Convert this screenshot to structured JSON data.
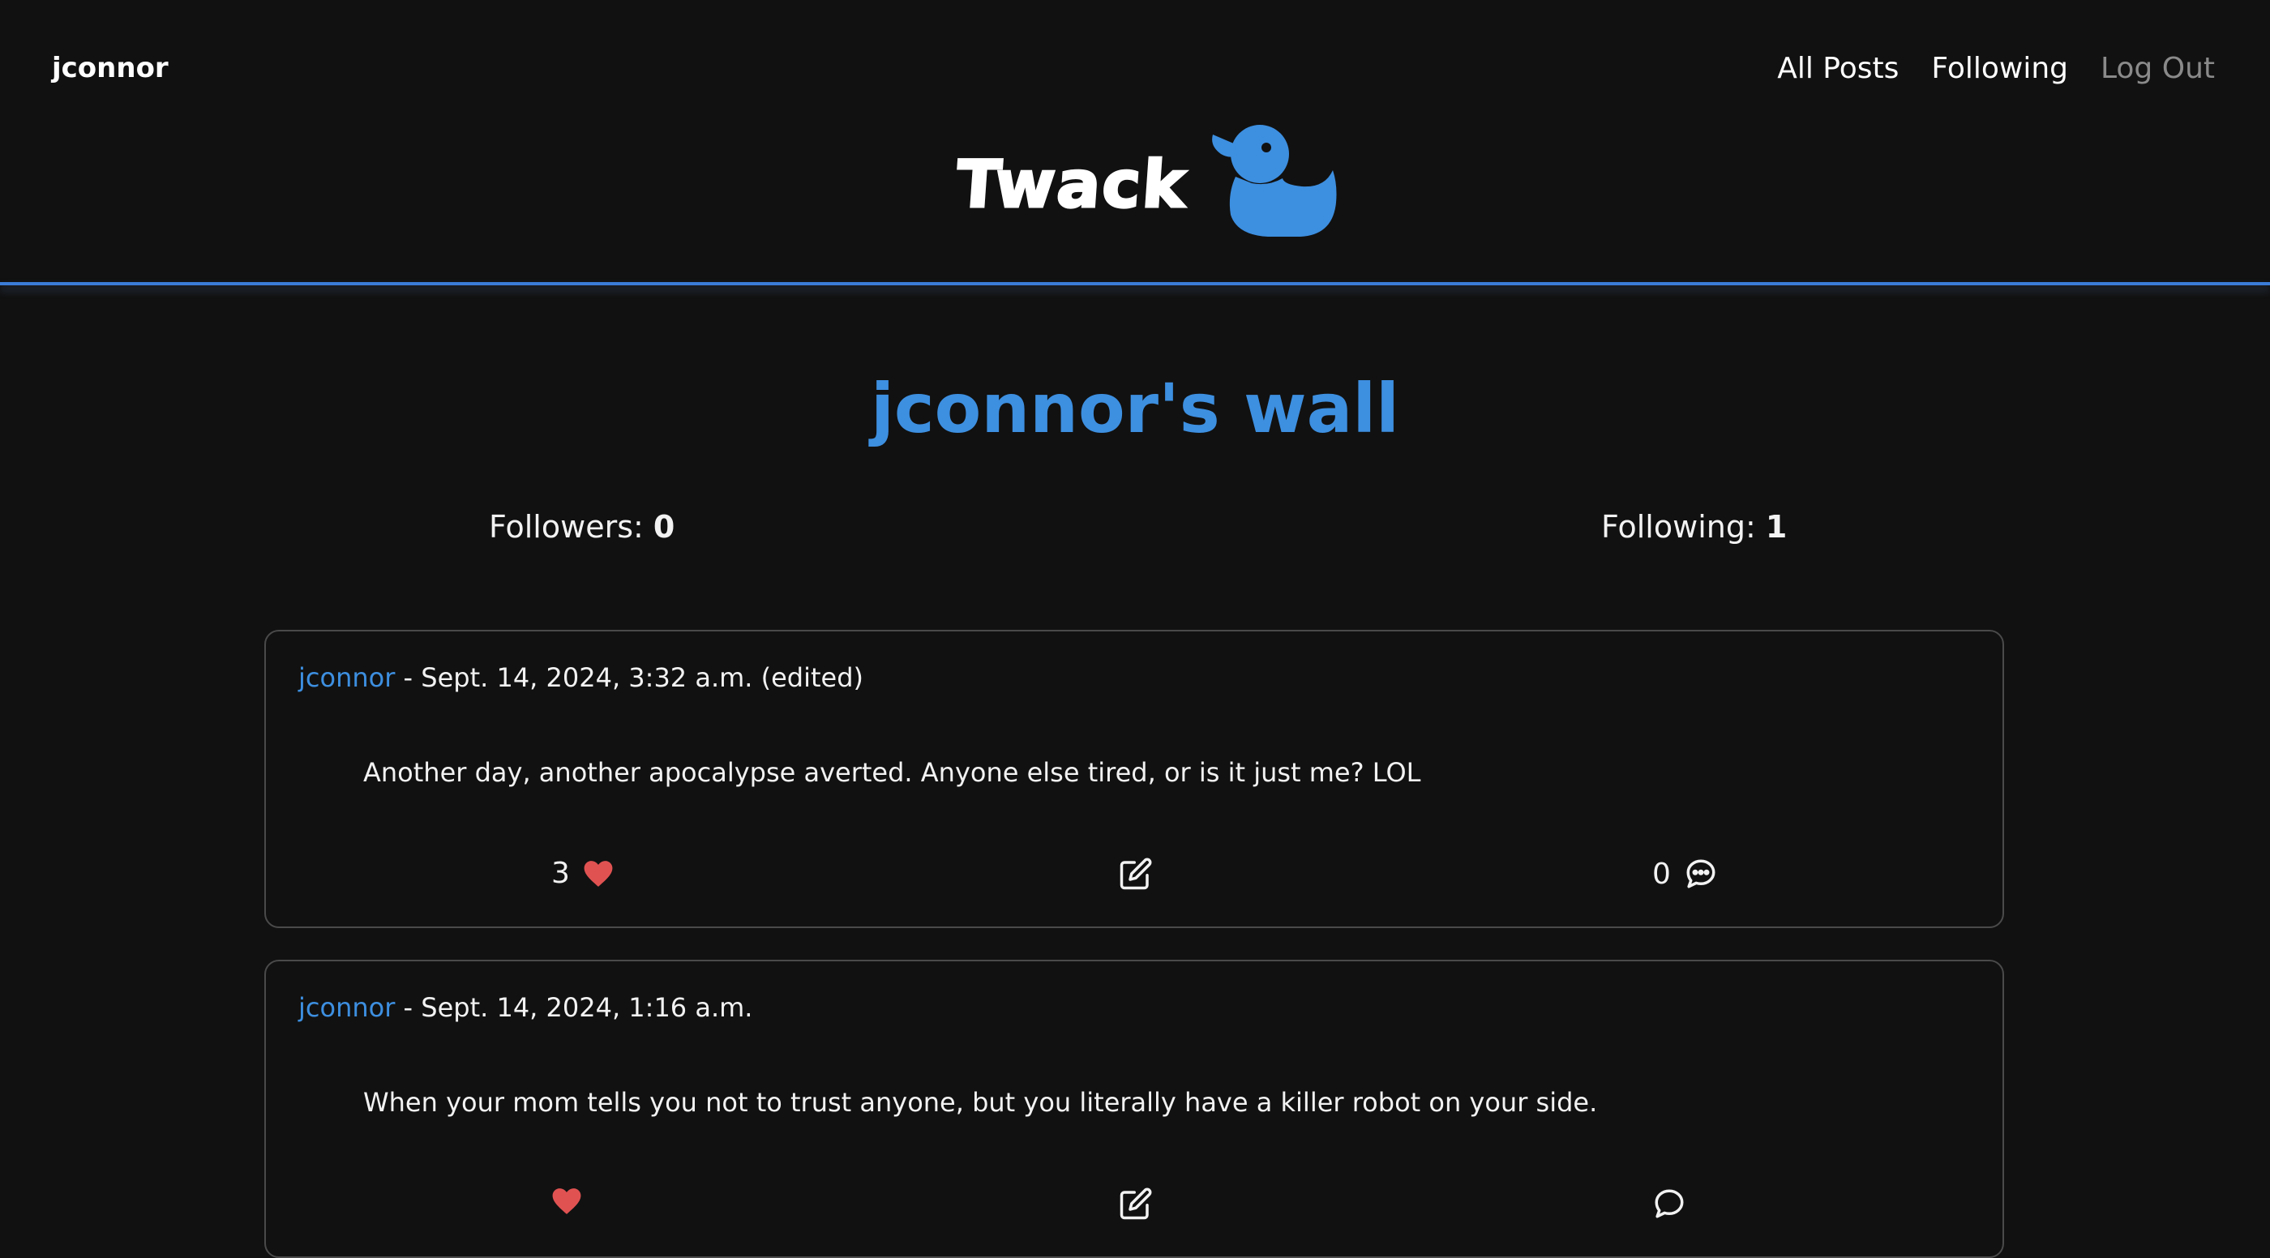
{
  "header": {
    "username": "jconnor",
    "nav": [
      {
        "label": "All Posts"
      },
      {
        "label": "Following"
      },
      {
        "label": "Log Out"
      }
    ],
    "logo_text": "Twack",
    "logo_icon": "duck-icon",
    "accent_color": "#3d8fe0"
  },
  "wall": {
    "title": "jconnor's wall",
    "followers_label": "Followers:",
    "followers_count": "0",
    "following_label": "Following:",
    "following_count": "1"
  },
  "posts": [
    {
      "author": "jconnor",
      "meta": " - Sept. 14, 2024, 3:32 a.m. (edited)",
      "body": "Another day, another apocalypse averted. Anyone else tired, or is it just me? LOL",
      "likes": "3",
      "comments": "0"
    },
    {
      "author": "jconnor",
      "meta": " - Sept. 14, 2024, 1:16 a.m.",
      "body": "When your mom tells you not to trust anyone, but you literally have a killer robot on your side."
    }
  ]
}
